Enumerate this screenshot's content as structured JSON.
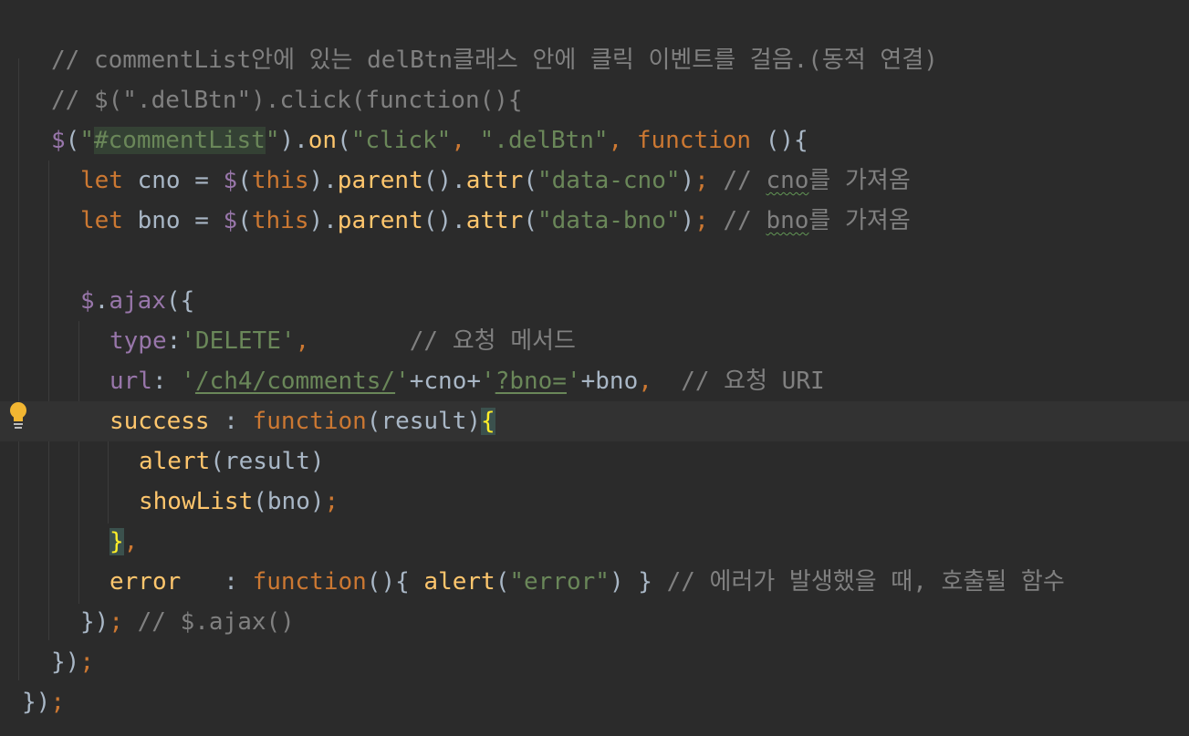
{
  "editor": {
    "lines": [
      {
        "tokens": [
          {
            "t": "// commentList안에 있는 delBtn클래스 안에 클릭 이벤트를 걸음.(동적 연결)",
            "c": "c-com"
          }
        ]
      },
      {
        "tokens": [
          {
            "t": "// $(\".delBtn\").click(function(){",
            "c": "c-com"
          }
        ]
      },
      {
        "tokens": [
          {
            "t": "$",
            "c": "c-dollar"
          },
          {
            "t": "(",
            "c": "c-white"
          },
          {
            "t": "\"",
            "c": "c-str"
          },
          {
            "t": "#commentList",
            "c": "c-str c-hlbox"
          },
          {
            "t": "\"",
            "c": "c-str"
          },
          {
            "t": ").",
            "c": "c-white"
          },
          {
            "t": "on",
            "c": "c-fn"
          },
          {
            "t": "(",
            "c": "c-white"
          },
          {
            "t": "\"click\"",
            "c": "c-str"
          },
          {
            "t": ", ",
            "c": "c-kw"
          },
          {
            "t": "\".delBtn\"",
            "c": "c-str"
          },
          {
            "t": ", ",
            "c": "c-kw"
          },
          {
            "t": "function ",
            "c": "c-kw"
          },
          {
            "t": "(){",
            "c": "c-white"
          }
        ]
      },
      {
        "tokens": [
          {
            "t": "let ",
            "c": "c-kw"
          },
          {
            "t": "cno = ",
            "c": "c-white"
          },
          {
            "t": "$",
            "c": "c-dollar"
          },
          {
            "t": "(",
            "c": "c-white"
          },
          {
            "t": "this",
            "c": "c-kw"
          },
          {
            "t": ").",
            "c": "c-white"
          },
          {
            "t": "parent",
            "c": "c-fn"
          },
          {
            "t": "().",
            "c": "c-white"
          },
          {
            "t": "attr",
            "c": "c-fn"
          },
          {
            "t": "(",
            "c": "c-white"
          },
          {
            "t": "\"data-cno\"",
            "c": "c-str"
          },
          {
            "t": ")",
            "c": "c-white"
          },
          {
            "t": "; ",
            "c": "c-kw"
          },
          {
            "t": "// ",
            "c": "c-com"
          },
          {
            "t": "cno",
            "c": "c-com squig"
          },
          {
            "t": "를 가져옴",
            "c": "c-com"
          }
        ]
      },
      {
        "tokens": [
          {
            "t": "let ",
            "c": "c-kw"
          },
          {
            "t": "bno = ",
            "c": "c-white"
          },
          {
            "t": "$",
            "c": "c-dollar"
          },
          {
            "t": "(",
            "c": "c-white"
          },
          {
            "t": "this",
            "c": "c-kw"
          },
          {
            "t": ").",
            "c": "c-white"
          },
          {
            "t": "parent",
            "c": "c-fn"
          },
          {
            "t": "().",
            "c": "c-white"
          },
          {
            "t": "attr",
            "c": "c-fn"
          },
          {
            "t": "(",
            "c": "c-white"
          },
          {
            "t": "\"data-bno\"",
            "c": "c-str"
          },
          {
            "t": ")",
            "c": "c-white"
          },
          {
            "t": "; ",
            "c": "c-kw"
          },
          {
            "t": "// ",
            "c": "c-com"
          },
          {
            "t": "bno",
            "c": "c-com squig"
          },
          {
            "t": "를 가져옴",
            "c": "c-com"
          }
        ]
      },
      {
        "tokens": []
      },
      {
        "tokens": [
          {
            "t": "$",
            "c": "c-dollar"
          },
          {
            "t": ".",
            "c": "c-white"
          },
          {
            "t": "ajax",
            "c": "c-prop"
          },
          {
            "t": "({",
            "c": "c-white"
          }
        ]
      },
      {
        "tokens": [
          {
            "t": "type",
            "c": "c-prop"
          },
          {
            "t": ":",
            "c": "c-white"
          },
          {
            "t": "'DELETE'",
            "c": "c-str"
          },
          {
            "t": ",       ",
            "c": "c-kw"
          },
          {
            "t": "// 요청 메서드",
            "c": "c-com"
          }
        ]
      },
      {
        "tokens": [
          {
            "t": "url",
            "c": "c-prop"
          },
          {
            "t": ": ",
            "c": "c-white"
          },
          {
            "t": "'",
            "c": "c-str"
          },
          {
            "t": "/ch4/comments/",
            "c": "c-str uline"
          },
          {
            "t": "'",
            "c": "c-str"
          },
          {
            "t": "+cno+",
            "c": "c-white"
          },
          {
            "t": "'",
            "c": "c-str"
          },
          {
            "t": "?bno=",
            "c": "c-str uline"
          },
          {
            "t": "'",
            "c": "c-str"
          },
          {
            "t": "+bno",
            "c": "c-white"
          },
          {
            "t": ",  ",
            "c": "c-kw"
          },
          {
            "t": "// 요청 URI",
            "c": "c-com"
          }
        ]
      },
      {
        "tokens": [
          {
            "t": "success",
            "c": "c-fn"
          },
          {
            "t": " : ",
            "c": "c-white"
          },
          {
            "t": "function",
            "c": "c-kw"
          },
          {
            "t": "(result)",
            "c": "c-white"
          },
          {
            "t": "{",
            "c": "c-brace-hl"
          }
        ]
      },
      {
        "tokens": [
          {
            "t": "alert",
            "c": "c-fn"
          },
          {
            "t": "(result)",
            "c": "c-white"
          }
        ]
      },
      {
        "tokens": [
          {
            "t": "showList",
            "c": "c-fn"
          },
          {
            "t": "(bno)",
            "c": "c-white"
          },
          {
            "t": ";",
            "c": "c-kw"
          }
        ]
      },
      {
        "tokens": [
          {
            "t": "}",
            "c": "c-brace-hl"
          },
          {
            "t": ",",
            "c": "c-kw"
          }
        ]
      },
      {
        "tokens": [
          {
            "t": "error",
            "c": "c-fn"
          },
          {
            "t": "   : ",
            "c": "c-white"
          },
          {
            "t": "function",
            "c": "c-kw"
          },
          {
            "t": "(){ ",
            "c": "c-white"
          },
          {
            "t": "alert",
            "c": "c-fn"
          },
          {
            "t": "(",
            "c": "c-white"
          },
          {
            "t": "\"error\"",
            "c": "c-str"
          },
          {
            "t": ") } ",
            "c": "c-white"
          },
          {
            "t": "// 에러가 발생했을 때, 호출될 함수",
            "c": "c-com"
          }
        ]
      },
      {
        "tokens": [
          {
            "t": "})",
            "c": "c-white"
          },
          {
            "t": "; ",
            "c": "c-kw"
          },
          {
            "t": "// $.ajax()",
            "c": "c-com"
          }
        ]
      },
      {
        "tokens": [
          {
            "t": "})",
            "c": "c-white"
          },
          {
            "t": ";",
            "c": "c-kw"
          }
        ]
      },
      {
        "tokens": [
          {
            "t": "})",
            "c": "c-white"
          },
          {
            "t": ";",
            "c": "c-kw"
          }
        ]
      }
    ],
    "intention_icon": "lightbulb-icon",
    "colors": {
      "background": "#2b2b2b",
      "caret_line": "#323232",
      "keyword": "#cc7832",
      "string": "#6a8759",
      "function": "#ffc66d",
      "property": "#9876aa",
      "comment": "#808080",
      "text": "#a9b7c6"
    }
  }
}
